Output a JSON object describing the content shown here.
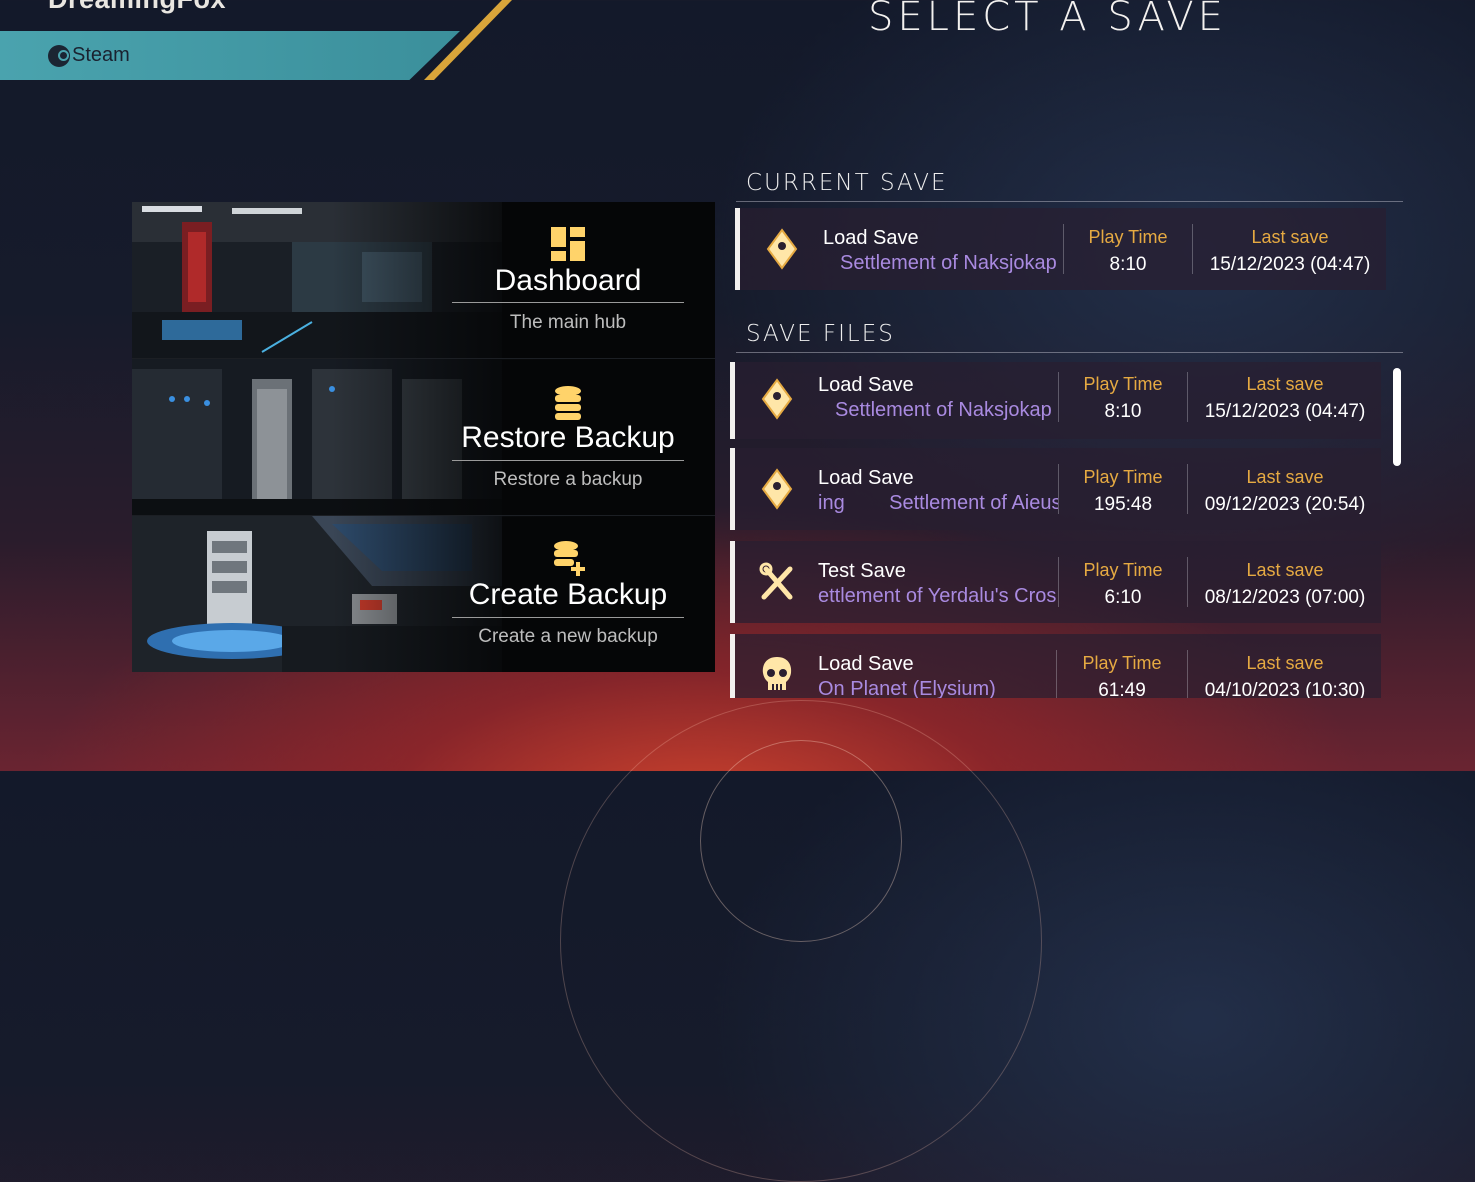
{
  "header": {
    "user_name": "DreamingFox",
    "platform": "Steam",
    "page_title": "SELECT A SAVE"
  },
  "menu": [
    {
      "title": "Dashboard",
      "subtitle": "The main hub",
      "icon": "dashboard-icon"
    },
    {
      "title": "Restore Backup",
      "subtitle": "Restore a backup",
      "icon": "database-icon"
    },
    {
      "title": "Create Backup",
      "subtitle": "Create a new backup",
      "icon": "database-add-icon"
    }
  ],
  "current_save": {
    "heading": "CURRENT SAVE",
    "save": {
      "name": "Load Save",
      "location": "Settlement of Naksjokap",
      "play_time_label": "Play Time",
      "play_time": "8:10",
      "last_save_label": "Last save",
      "last_save": "15/12/2023 (04:47)",
      "icon": "location-pin-icon"
    }
  },
  "save_files": {
    "heading": "SAVE FILES",
    "items": [
      {
        "name": "Load Save",
        "location": "Settlement of Naksjokap",
        "play_time_label": "Play Time",
        "play_time": "8:10",
        "last_save_label": "Last save",
        "last_save": "15/12/2023 (04:47)",
        "icon": "location-pin-icon"
      },
      {
        "name": "Load Save",
        "location": "ing        Settlement of Aieus",
        "play_time_label": "Play Time",
        "play_time": "195:48",
        "last_save_label": "Last save",
        "last_save": "09/12/2023 (20:54)",
        "icon": "location-pin-icon"
      },
      {
        "name": "Test Save",
        "location": "ettlement of Yerdalu's Cros",
        "play_time_label": "Play Time",
        "play_time": "6:10",
        "last_save_label": "Last save",
        "last_save": "08/12/2023 (07:00)",
        "icon": "tools-icon"
      },
      {
        "name": "Load Save",
        "location": "On Planet (Elysium)",
        "play_time_label": "Play Time",
        "play_time": "61:49",
        "last_save_label": "Last save",
        "last_save": "04/10/2023 (10:30)",
        "icon": "skull-icon"
      }
    ]
  },
  "colors": {
    "accent_gold": "#e6aa42",
    "location_purple": "#a98ae0",
    "platform_teal": "#4aa3ae"
  }
}
